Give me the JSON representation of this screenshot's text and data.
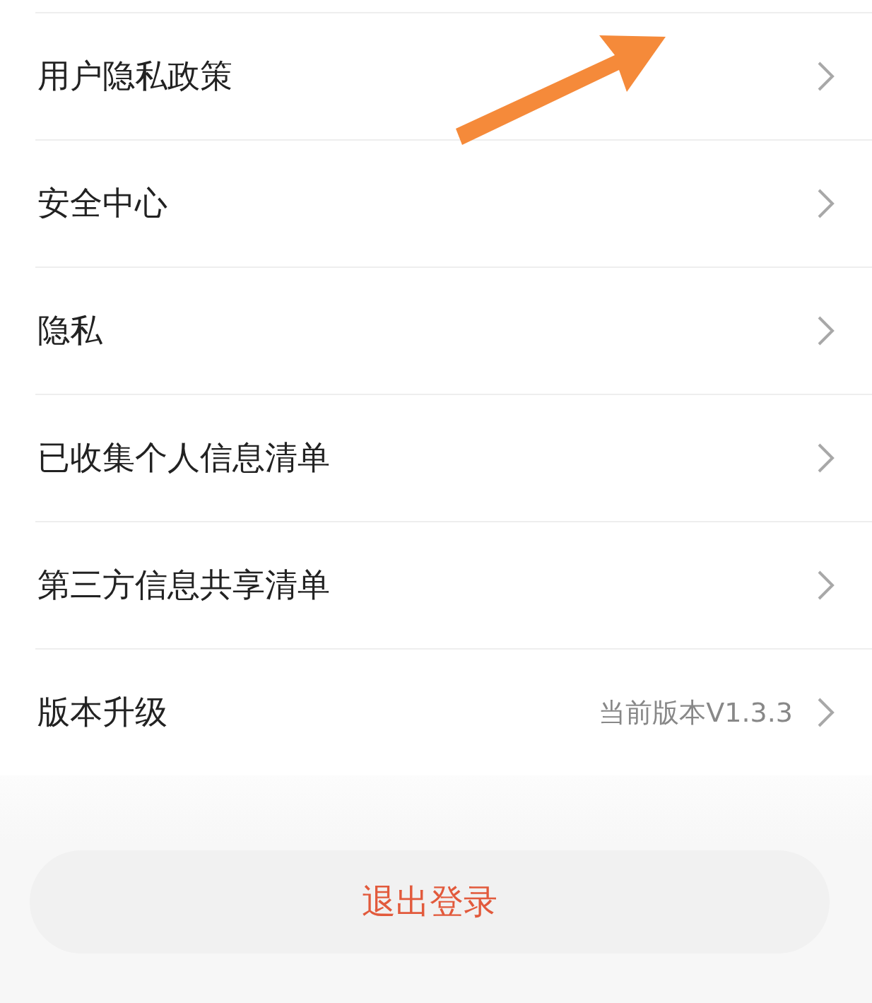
{
  "menu": {
    "items": [
      {
        "label": "用户隐私政策"
      },
      {
        "label": "安全中心"
      },
      {
        "label": "隐私"
      },
      {
        "label": "已收集个人信息清单"
      },
      {
        "label": "第三方信息共享清单"
      },
      {
        "label": "版本升级",
        "value": "当前版本V1.3.3"
      }
    ]
  },
  "logout_button": {
    "label": "退出登录"
  }
}
